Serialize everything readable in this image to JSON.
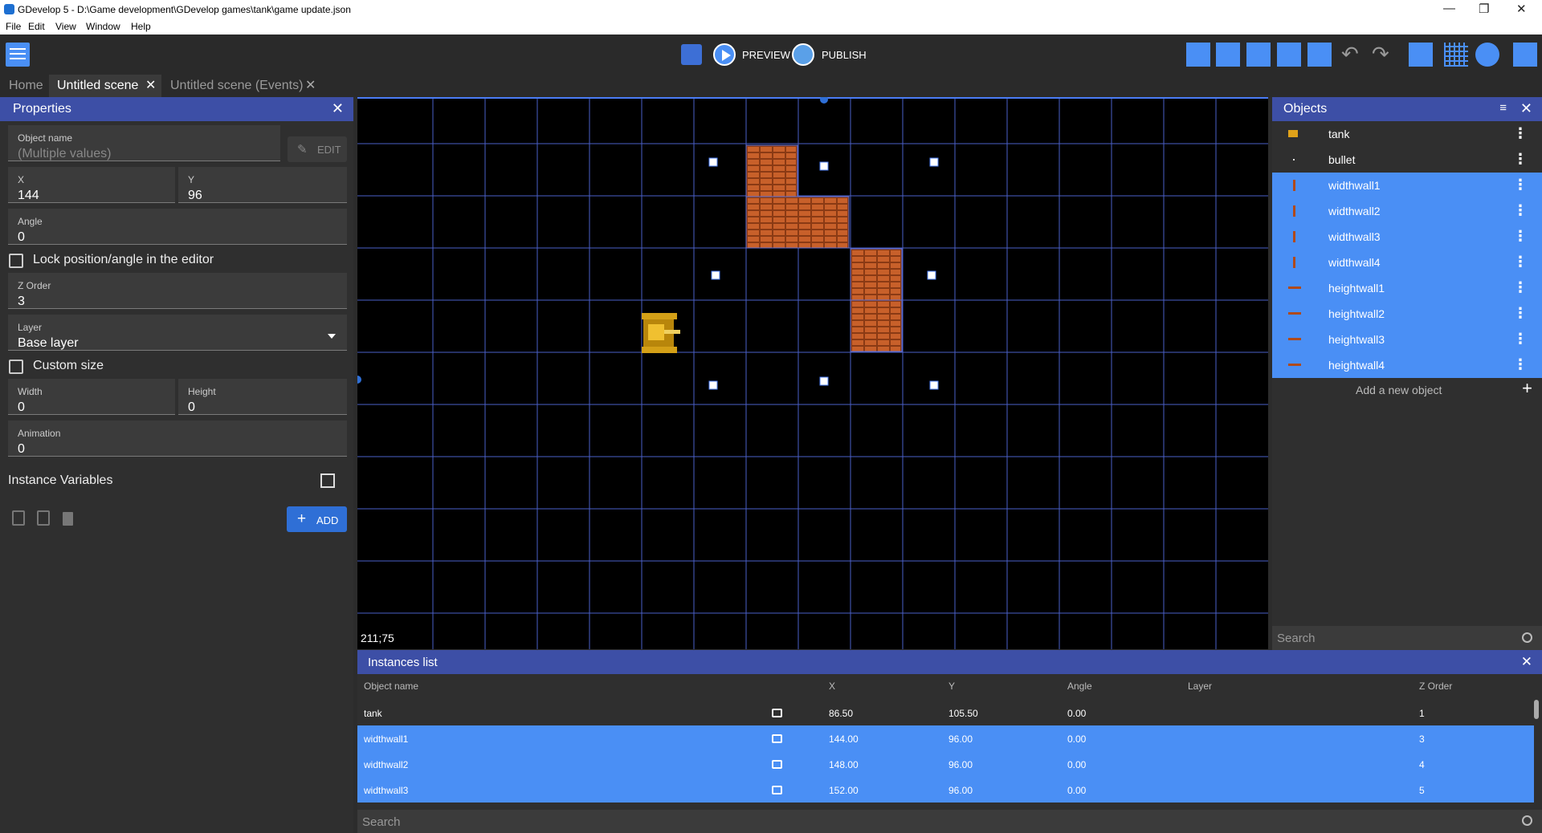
{
  "window": {
    "title": "GDevelop 5 - D:\\Game development\\GDevelop games\\tank\\game update.json",
    "minimize": "—",
    "restore": "❐",
    "close": "✕"
  },
  "menu": [
    "File",
    "Edit",
    "View",
    "Window",
    "Help"
  ],
  "toolbar": {
    "preview": "PREVIEW",
    "publish": "PUBLISH"
  },
  "tabs": [
    {
      "label": "Home"
    },
    {
      "label": "Untitled scene"
    },
    {
      "label": "Untitled scene (Events)"
    }
  ],
  "tab_close": "✕",
  "properties": {
    "title": "Properties",
    "close": "✕",
    "object_name_label": "Object name",
    "object_name_placeholder": "(Multiple values)",
    "edit": "EDIT",
    "x_label": "X",
    "x": "144",
    "y_label": "Y",
    "y": "96",
    "angle_label": "Angle",
    "angle": "0",
    "lock_label": "Lock position/angle in the editor",
    "z_label": "Z Order",
    "z": "3",
    "layer_label": "Layer",
    "layer": "Base layer",
    "custom_size_label": "Custom size",
    "width_label": "Width",
    "width": "0",
    "height_label": "Height",
    "height": "0",
    "animation_label": "Animation",
    "animation": "0",
    "instance_vars": "Instance Variables",
    "add": "ADD"
  },
  "scene": {
    "coords": "211;75"
  },
  "objects": {
    "title": "Objects",
    "close": "✕",
    "items": [
      {
        "name": "tank",
        "selected": false,
        "icon": "tank-icon"
      },
      {
        "name": "bullet",
        "selected": false,
        "icon": "bullet-icon"
      },
      {
        "name": "widthwall1",
        "selected": true,
        "icon": "vertical-wall-icon"
      },
      {
        "name": "widthwall2",
        "selected": true,
        "icon": "vertical-wall-icon"
      },
      {
        "name": "widthwall3",
        "selected": true,
        "icon": "vertical-wall-icon"
      },
      {
        "name": "widthwall4",
        "selected": true,
        "icon": "vertical-wall-icon"
      },
      {
        "name": "heightwall1",
        "selected": true,
        "icon": "horizontal-wall-icon"
      },
      {
        "name": "heightwall2",
        "selected": true,
        "icon": "horizontal-wall-icon"
      },
      {
        "name": "heightwall3",
        "selected": true,
        "icon": "horizontal-wall-icon"
      },
      {
        "name": "heightwall4",
        "selected": true,
        "icon": "horizontal-wall-icon"
      }
    ],
    "add_new": "Add a new object",
    "add_icon": "+",
    "search_placeholder": "Search"
  },
  "instances": {
    "title": "Instances list",
    "close": "✕",
    "columns": [
      "Object name",
      "X",
      "Y",
      "Angle",
      "Layer",
      "Z Order"
    ],
    "rows": [
      {
        "name": "tank",
        "x": "86.50",
        "y": "105.50",
        "angle": "0.00",
        "layer": "",
        "z": "1",
        "selected": false
      },
      {
        "name": "widthwall1",
        "x": "144.00",
        "y": "96.00",
        "angle": "0.00",
        "layer": "",
        "z": "3",
        "selected": true
      },
      {
        "name": "widthwall2",
        "x": "148.00",
        "y": "96.00",
        "angle": "0.00",
        "layer": "",
        "z": "4",
        "selected": true
      },
      {
        "name": "widthwall3",
        "x": "152.00",
        "y": "96.00",
        "angle": "0.00",
        "layer": "",
        "z": "5",
        "selected": true
      }
    ],
    "search_placeholder": "Search"
  },
  "colors": {
    "accent": "#3d4fa6",
    "selection": "#4a8ff5",
    "grid": "#4a5fc7",
    "brick": "#b04a1a"
  }
}
